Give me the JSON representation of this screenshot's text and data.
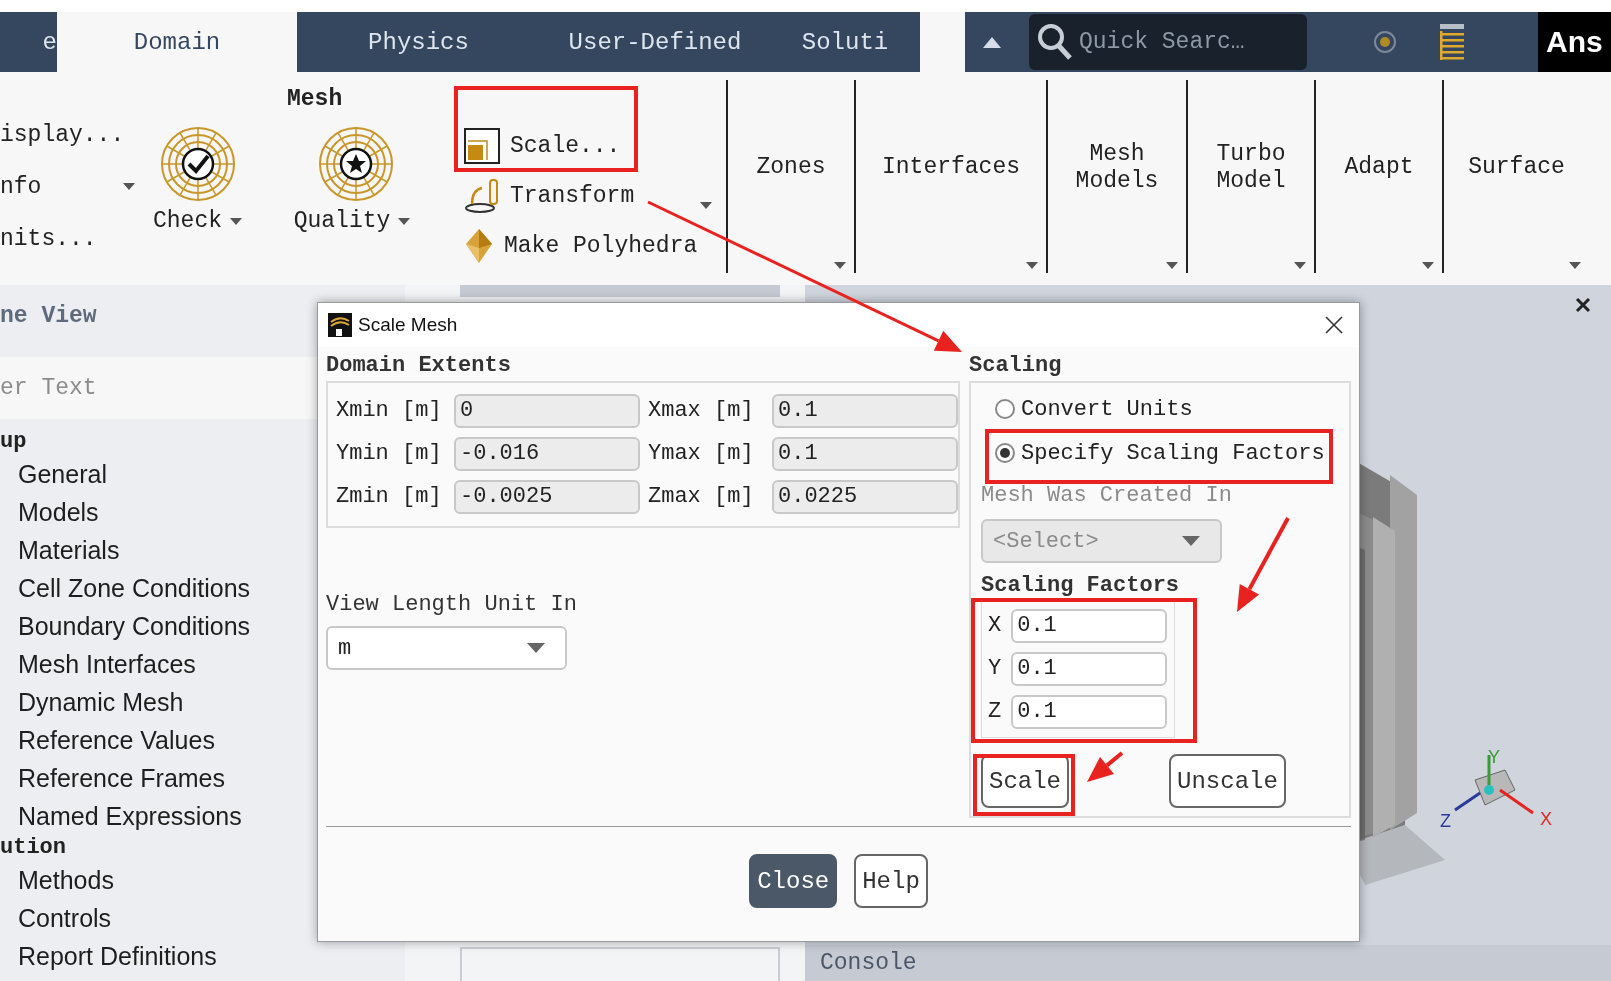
{
  "tabs": [
    {
      "label": "e",
      "selected": false
    },
    {
      "label": "Domain",
      "selected": true
    },
    {
      "label": "Physics",
      "selected": false
    },
    {
      "label": "User-Defined",
      "selected": false
    },
    {
      "label": "Soluti",
      "selected": false
    }
  ],
  "quick_search": {
    "placeholder": "Quick Searc…"
  },
  "logo": "Ans",
  "ribbon": {
    "left_items": [
      {
        "label": "isplay...",
        "has_menu": false
      },
      {
        "label": "nfo",
        "has_menu": true
      },
      {
        "label": "nits...",
        "has_menu": false
      }
    ],
    "mesh_group": {
      "label": "Mesh",
      "tools": [
        {
          "label": "Check",
          "kind": "check"
        },
        {
          "label": "Quality",
          "kind": "quality"
        }
      ]
    },
    "mesh_actions": [
      {
        "label": "Scale...",
        "kind": "scale"
      },
      {
        "label": "Transform",
        "kind": "transform"
      },
      {
        "label": "Make Polyhedra",
        "kind": "polyhedra"
      }
    ],
    "groups": [
      {
        "label": "Zones"
      },
      {
        "label": "Interfaces"
      },
      {
        "label": "Mesh\nModels"
      },
      {
        "label": "Turbo\nModel"
      },
      {
        "label": "Adapt"
      },
      {
        "label": "Surface"
      }
    ]
  },
  "outline": {
    "title": "ne View",
    "filter_placeholder": "er Text",
    "sections": [
      {
        "label": "up",
        "children": [
          {
            "label": "General"
          },
          {
            "label": "Models"
          },
          {
            "label": "Materials"
          },
          {
            "label": "Cell Zone Conditions"
          },
          {
            "label": "Boundary Conditions"
          },
          {
            "label": "Mesh Interfaces"
          },
          {
            "label": "Dynamic Mesh"
          },
          {
            "label": "Reference Values"
          },
          {
            "label": "Reference Frames"
          },
          {
            "label": "Named Expressions"
          }
        ]
      },
      {
        "label": "ution",
        "children": [
          {
            "label": "Methods"
          },
          {
            "label": "Controls"
          },
          {
            "label": "Report Definitions"
          }
        ]
      }
    ]
  },
  "dialog": {
    "title": "Scale Mesh",
    "domain_extents": {
      "title": "Domain Extents",
      "rows": [
        {
          "min_label": "Xmin [m]",
          "min_value": "0",
          "max_label": "Xmax [m]",
          "max_value": "0.1"
        },
        {
          "min_label": "Ymin [m]",
          "min_value": "-0.016",
          "max_label": "Ymax [m]",
          "max_value": "0.1"
        },
        {
          "min_label": "Zmin [m]",
          "min_value": "-0.0025",
          "max_label": "Zmax [m]",
          "max_value": "0.0225"
        }
      ]
    },
    "view_length_unit": {
      "label": "View Length Unit In",
      "value": "m"
    },
    "scaling": {
      "title": "Scaling",
      "options": [
        {
          "label": "Convert Units",
          "selected": false
        },
        {
          "label": "Specify Scaling Factors",
          "selected": true
        }
      ],
      "mesh_created_in": {
        "label": "Mesh Was Created In",
        "value": "<Select>",
        "disabled": true
      },
      "factors_title": "Scaling Factors",
      "factors": [
        {
          "axis": "X",
          "value": "0.1"
        },
        {
          "axis": "Y",
          "value": "0.1"
        },
        {
          "axis": "Z",
          "value": "0.1"
        }
      ],
      "buttons": [
        "Scale",
        "Unscale"
      ]
    },
    "footer_buttons": [
      {
        "label": "Close",
        "primary": true
      },
      {
        "label": "Help",
        "primary": false
      }
    ]
  },
  "graphics": {
    "axes": [
      "X",
      "Y",
      "Z"
    ]
  },
  "console": {
    "label": "Console"
  }
}
